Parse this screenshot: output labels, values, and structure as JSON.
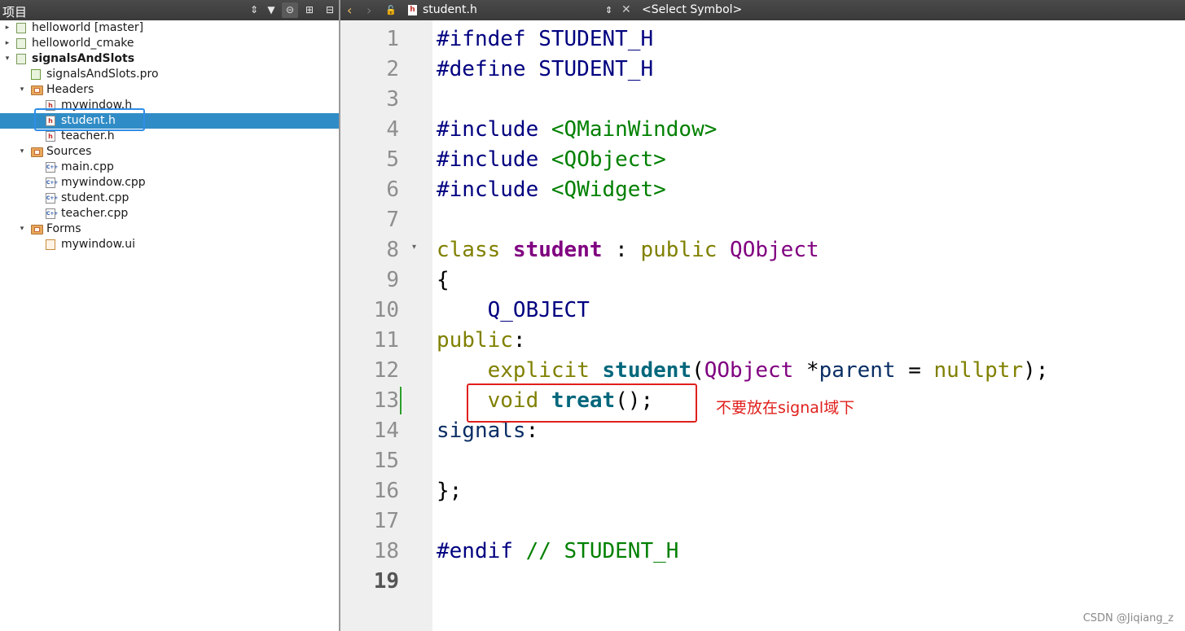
{
  "left_pane": {
    "title": "项目",
    "tree": [
      {
        "label": "helloworld [master]",
        "level": 0,
        "arrow": "collapsed",
        "icon": "project-icon",
        "bold": false
      },
      {
        "label": "helloworld_cmake",
        "level": 0,
        "arrow": "collapsed",
        "icon": "cmake-project-icon",
        "bold": false
      },
      {
        "label": "signalsAndSlots",
        "level": 0,
        "arrow": "expanded",
        "icon": "project-icon",
        "bold": true
      },
      {
        "label": "signalsAndSlots.pro",
        "level": 1,
        "arrow": "none",
        "icon": "pro-file-icon",
        "bold": false
      },
      {
        "label": "Headers",
        "level": 1,
        "arrow": "expanded",
        "icon": "folder-icon",
        "bold": false
      },
      {
        "label": "mywindow.h",
        "level": 2,
        "arrow": "none",
        "icon": "header-file-icon",
        "bold": false
      },
      {
        "label": "student.h",
        "level": 2,
        "arrow": "none",
        "icon": "header-file-icon",
        "bold": false,
        "selected": true
      },
      {
        "label": "teacher.h",
        "level": 2,
        "arrow": "none",
        "icon": "header-file-icon",
        "bold": false
      },
      {
        "label": "Sources",
        "level": 1,
        "arrow": "expanded",
        "icon": "folder-icon",
        "bold": false
      },
      {
        "label": "main.cpp",
        "level": 2,
        "arrow": "none",
        "icon": "cpp-file-icon",
        "bold": false
      },
      {
        "label": "mywindow.cpp",
        "level": 2,
        "arrow": "none",
        "icon": "cpp-file-icon",
        "bold": false
      },
      {
        "label": "student.cpp",
        "level": 2,
        "arrow": "none",
        "icon": "cpp-file-icon",
        "bold": false
      },
      {
        "label": "teacher.cpp",
        "level": 2,
        "arrow": "none",
        "icon": "cpp-file-icon",
        "bold": false
      },
      {
        "label": "Forms",
        "level": 1,
        "arrow": "expanded",
        "icon": "folder-icon",
        "bold": false
      },
      {
        "label": "mywindow.ui",
        "level": 2,
        "arrow": "none",
        "icon": "ui-file-icon",
        "bold": false
      }
    ]
  },
  "editor": {
    "file_name": "student.h",
    "symbol_placeholder": "<Select Symbol>",
    "current_line": 19,
    "lines": [
      [
        {
          "t": "#ifndef STUDENT_H",
          "c": "pre"
        }
      ],
      [
        {
          "t": "#define STUDENT_H",
          "c": "pre"
        }
      ],
      [],
      [
        {
          "t": "#include ",
          "c": "pre"
        },
        {
          "t": "<QMainWindow>",
          "c": "inc"
        }
      ],
      [
        {
          "t": "#include ",
          "c": "pre"
        },
        {
          "t": "<QObject>",
          "c": "inc"
        }
      ],
      [
        {
          "t": "#include ",
          "c": "pre"
        },
        {
          "t": "<QWidget>",
          "c": "inc"
        }
      ],
      [],
      [
        {
          "t": "class ",
          "c": "kw"
        },
        {
          "t": "student",
          "c": "cls"
        },
        {
          "t": " : ",
          "c": "punct"
        },
        {
          "t": "public ",
          "c": "kw"
        },
        {
          "t": "QObject",
          "c": "type"
        }
      ],
      [
        {
          "t": "{",
          "c": "punct"
        }
      ],
      [
        {
          "t": "    ",
          "c": "punct"
        },
        {
          "t": "Q_OBJECT",
          "c": "macro"
        }
      ],
      [
        {
          "t": "public",
          "c": "kw"
        },
        {
          "t": ":",
          "c": "punct"
        }
      ],
      [
        {
          "t": "    ",
          "c": "punct"
        },
        {
          "t": "explicit ",
          "c": "kw"
        },
        {
          "t": "student",
          "c": "fn"
        },
        {
          "t": "(",
          "c": "punct"
        },
        {
          "t": "QObject",
          "c": "type"
        },
        {
          "t": " *",
          "c": "punct"
        },
        {
          "t": "parent",
          "c": "ident"
        },
        {
          "t": " = ",
          "c": "punct"
        },
        {
          "t": "nullptr",
          "c": "kw"
        },
        {
          "t": ");",
          "c": "punct"
        }
      ],
      [
        {
          "t": "    ",
          "c": "punct"
        },
        {
          "t": "void ",
          "c": "kw"
        },
        {
          "t": "treat",
          "c": "fn"
        },
        {
          "t": "();",
          "c": "punct"
        }
      ],
      [
        {
          "t": "signals",
          "c": "ident"
        },
        {
          "t": ":",
          "c": "punct"
        }
      ],
      [],
      [
        {
          "t": "};",
          "c": "punct"
        }
      ],
      [],
      [
        {
          "t": "#endif ",
          "c": "pre"
        },
        {
          "t": "// STUDENT_H",
          "c": "cmt"
        }
      ],
      []
    ]
  },
  "annotation": "不要放在signal域下",
  "watermark": "CSDN @Jiqiang_z",
  "colors": {
    "selection": "#308cc6",
    "annotation_red": "#e0201c",
    "highlight_blue": "#2f8de8",
    "toolbar_dark": "#404040"
  }
}
